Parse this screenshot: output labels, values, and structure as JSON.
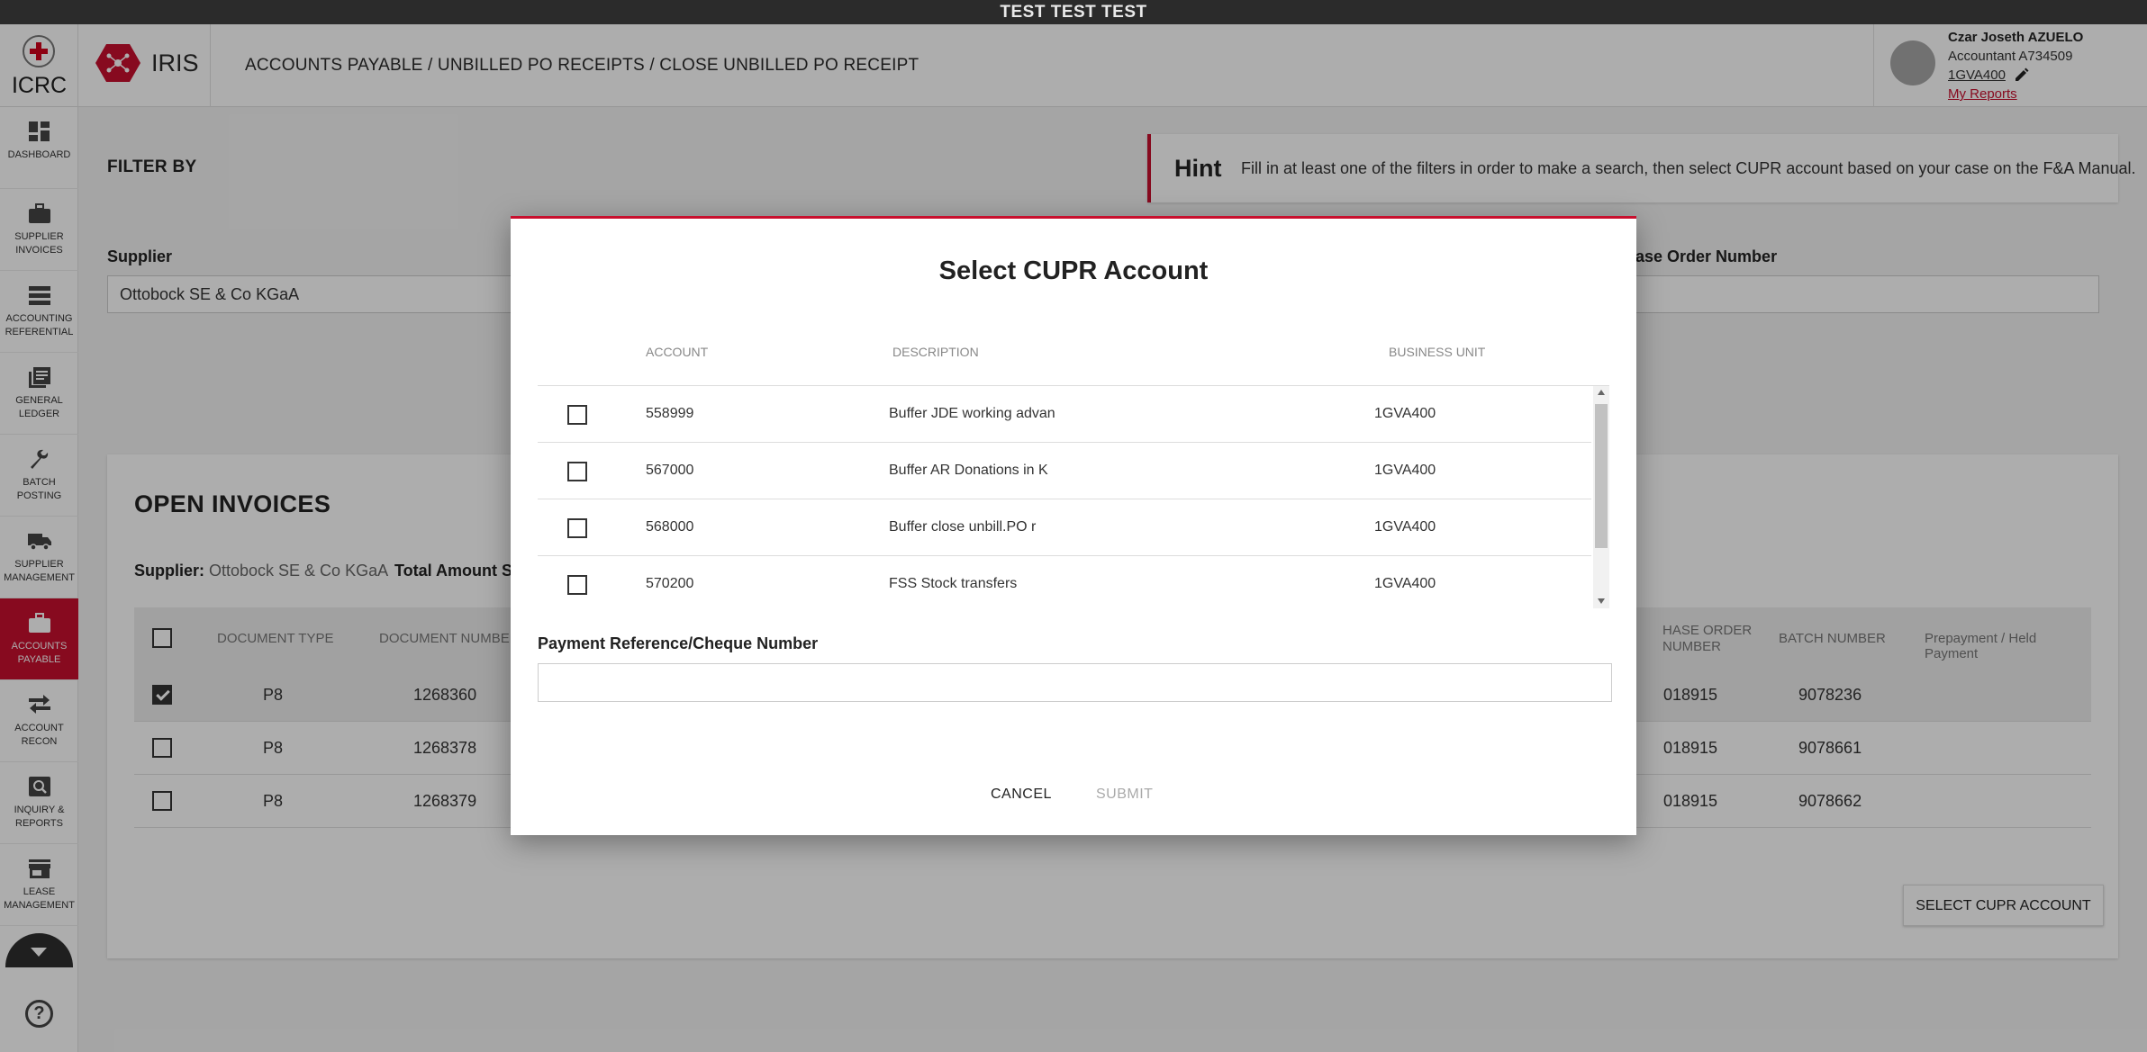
{
  "env_banner": "TEST TEST TEST",
  "header": {
    "org_name": "ICRC",
    "app_name": "IRIS",
    "breadcrumb": "ACCOUNTS PAYABLE / UNBILLED PO RECEIPTS / CLOSE UNBILLED PO RECEIPT"
  },
  "user": {
    "name": "Czar Joseth AZUELO",
    "role": "Accountant A734509",
    "business_unit": "1GVA400",
    "reports_link": "My Reports"
  },
  "sidebar": {
    "items": [
      {
        "label": "DASHBOARD",
        "icon": "dashboard-icon"
      },
      {
        "label": "SUPPLIER INVOICES",
        "icon": "briefcase-icon"
      },
      {
        "label": "ACCOUNTING REFERENTIAL",
        "icon": "list-icon"
      },
      {
        "label": "GENERAL LEDGER",
        "icon": "ledger-icon"
      },
      {
        "label": "BATCH POSTING",
        "icon": "wrench-icon"
      },
      {
        "label": "SUPPLIER MANAGEMENT",
        "icon": "truck-icon"
      },
      {
        "label": "ACCOUNTS PAYABLE",
        "icon": "briefcase-icon",
        "active": true
      },
      {
        "label": "ACCOUNT RECON",
        "icon": "arrows-icon"
      },
      {
        "label": "INQUIRY & REPORTS",
        "icon": "magnifier-icon"
      },
      {
        "label": "LEASE MANAGEMENT",
        "icon": "store-icon"
      }
    ],
    "help": "?"
  },
  "filter": {
    "title": "FILTER BY",
    "hint_title": "Hint",
    "hint_text": "Fill in at least one of the filters in order to make a search, then select CUPR account based on your case on the F&A Manual.",
    "supplier_label": "Supplier",
    "supplier_value": "Ottobock SE & Co KGaA",
    "po_label": "rchase Order Number"
  },
  "open_invoices": {
    "title": "OPEN INVOICES",
    "supplier_label": "Supplier:",
    "supplier_value": "Ottobock SE & Co KGaA",
    "total_label": "Total Amount Se",
    "columns": {
      "document_type": "DOCUMENT TYPE",
      "document_number": "DOCUMENT NUMBER",
      "po_number": "HASE ORDER NUMBER",
      "batch_number": "BATCH NUMBER",
      "prepayment": "Prepayment / Held Payment"
    },
    "rows": [
      {
        "doc_type": "P8",
        "doc_number": "1268360",
        "po": "018915",
        "batch": "9078236",
        "checked": true
      },
      {
        "doc_type": "P8",
        "doc_number": "1268378",
        "po": "018915",
        "batch": "9078661",
        "checked": false
      },
      {
        "doc_type": "P8",
        "doc_number": "1268379",
        "po": "018915",
        "batch": "9078662",
        "checked": false
      }
    ],
    "select_button": "SELECT CUPR ACCOUNT"
  },
  "modal": {
    "title": "Select CUPR Account",
    "columns": {
      "account": "ACCOUNT",
      "description": "DESCRIPTION",
      "business_unit": "BUSINESS UNIT"
    },
    "rows": [
      {
        "account": "558999",
        "description": "Buffer JDE working advan",
        "business_unit": "1GVA400"
      },
      {
        "account": "567000",
        "description": "Buffer AR Donations in K",
        "business_unit": "1GVA400"
      },
      {
        "account": "568000",
        "description": "Buffer close unbill.PO r",
        "business_unit": "1GVA400"
      },
      {
        "account": "570200",
        "description": "FSS Stock transfers",
        "business_unit": "1GVA400"
      }
    ],
    "payment_label": "Payment Reference/Cheque Number",
    "payment_value": "",
    "cancel": "CANCEL",
    "submit": "SUBMIT"
  },
  "colors": {
    "brand": "#c8102e",
    "banner": "#2b2b2b",
    "overlay": "rgba(0,0,0,0.32)"
  }
}
